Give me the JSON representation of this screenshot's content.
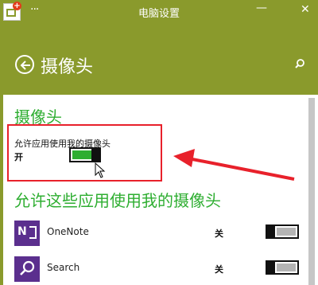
{
  "window": {
    "title": "电脑设置"
  },
  "header": {
    "title": "摄像头"
  },
  "camera_section": {
    "title": "摄像头",
    "allow_label": "允许应用使用我的摄像头",
    "allow_state": "开",
    "allow_on": true
  },
  "apps_section": {
    "title": "允许这些应用使用我的摄像头",
    "apps": [
      {
        "name": "OneNote",
        "state": "关",
        "on": false,
        "icon": "onenote-icon"
      },
      {
        "name": "Search",
        "state": "关",
        "on": false,
        "icon": "search-icon"
      }
    ]
  },
  "colors": {
    "accent": "#8a9a2c",
    "green_text": "#2eae31",
    "toggle_on": "#2eae31",
    "toggle_off": "#b4b4b4",
    "annotation_red": "#e8212b",
    "app_tile": "#5b2f8e"
  }
}
